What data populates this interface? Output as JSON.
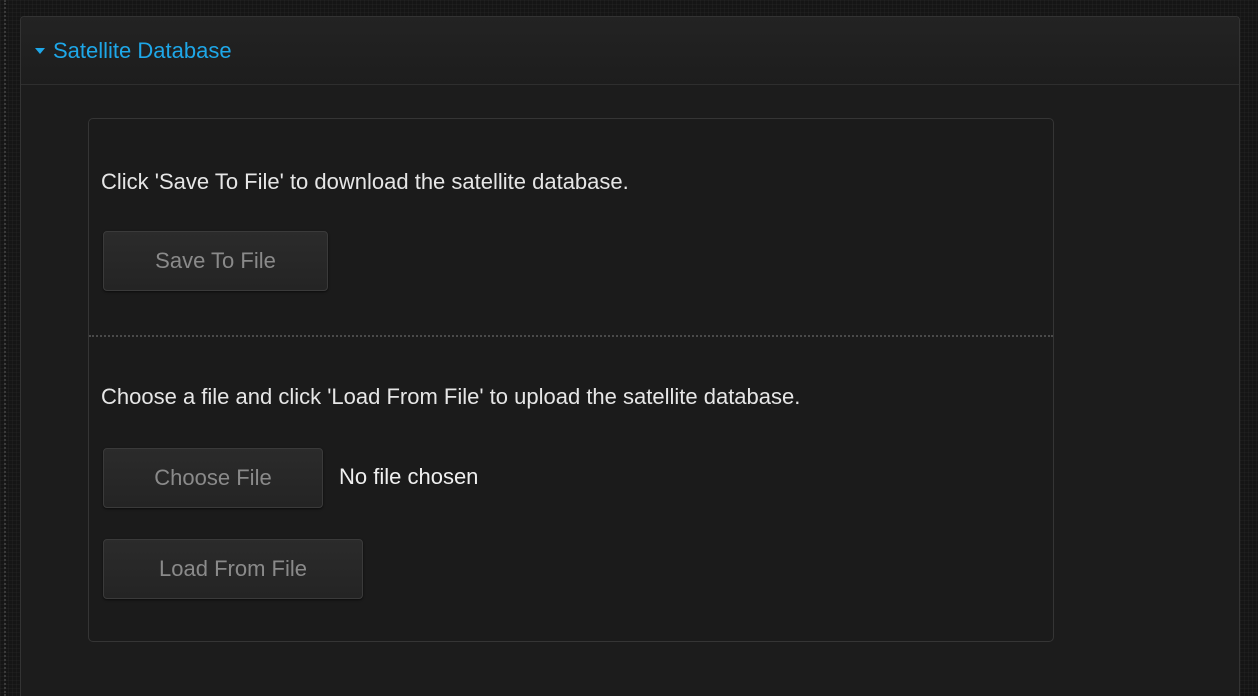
{
  "panel": {
    "title": "Satellite Database",
    "expanded": true,
    "accent_color": "#1ea7e8"
  },
  "save_section": {
    "description": "Click 'Save To File' to download the satellite database.",
    "button_label": "Save To File"
  },
  "load_section": {
    "description": "Choose a file and click 'Load From File' to upload the satellite database.",
    "choose_button_label": "Choose File",
    "file_status": "No file chosen",
    "load_button_label": "Load From File"
  },
  "icons": {
    "collapse": "caret-down-icon"
  }
}
